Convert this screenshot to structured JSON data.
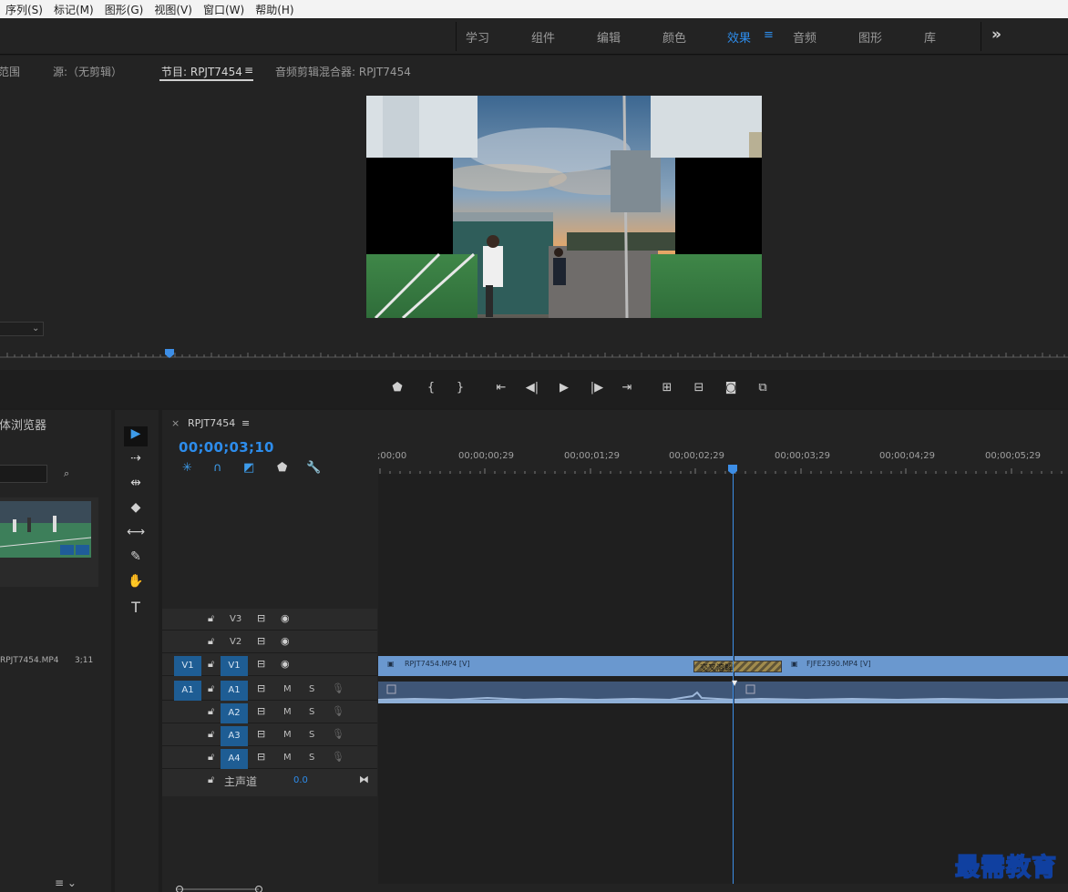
{
  "menu": [
    "序列(S)",
    "标记(M)",
    "图形(G)",
    "视图(V)",
    "窗口(W)",
    "帮助(H)"
  ],
  "workspaces": [
    {
      "label": "学习",
      "active": false
    },
    {
      "label": "组件",
      "active": false
    },
    {
      "label": "编辑",
      "active": false
    },
    {
      "label": "颜色",
      "active": false
    },
    {
      "label": "效果",
      "active": true
    },
    {
      "label": "音频",
      "active": false
    },
    {
      "label": "图形",
      "active": false
    },
    {
      "label": "库",
      "active": false
    }
  ],
  "monitor": {
    "tab_left_partial": "范围",
    "tab_source": "源:（无剪辑）",
    "tab_program": "节目: RPJT7454",
    "tab_mixer": "音频剪辑混合器: RPJT7454"
  },
  "project": {
    "title": "媒体浏览器",
    "clip_name": "RPJT7454.MP4",
    "clip_duration": "3;11"
  },
  "timeline": {
    "sequence_name": "RPJT7454",
    "timecode": "00;00;03;10",
    "ruler_labels": [
      ";00;00",
      "00;00;00;29",
      "00;00;01;29",
      "00;00;02;29",
      "00;00;03;29",
      "00;00;04;29",
      "00;00;05;29"
    ],
    "video_tracks": [
      {
        "name": "V3",
        "target": ""
      },
      {
        "name": "V2",
        "target": ""
      },
      {
        "name": "V1",
        "target": "V1"
      }
    ],
    "audio_tracks": [
      {
        "name": "A1",
        "target": "A1",
        "m": "M",
        "s": "S"
      },
      {
        "name": "A2",
        "target": "",
        "m": "M",
        "s": "S"
      },
      {
        "name": "A3",
        "target": "",
        "m": "M",
        "s": "S"
      },
      {
        "name": "A4",
        "target": "",
        "m": "M",
        "s": "S"
      }
    ],
    "master_label": "主声道",
    "master_value": "0.0",
    "clip1_label": "RPJT7454.MP4 [V]",
    "clip2_label": "FJFE2390.MP4 [V]",
    "transition_label": "交叉溶解"
  },
  "watermark": "最需教育",
  "colors": {
    "accent": "#2d8ceb",
    "clip_video": "#6a98cf",
    "clip_audio": "#3f5677"
  }
}
